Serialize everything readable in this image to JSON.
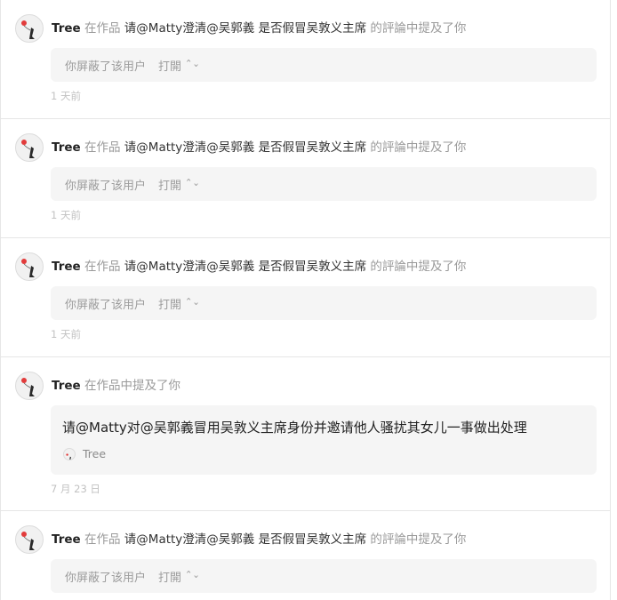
{
  "notifications": [
    {
      "author": "Tree",
      "prefix": "在作品",
      "work_title": "请@Matty澄清@吴郭義 是否假冒吴敦义主席",
      "suffix": "的評論中提及了你",
      "blocked_text": "你屏蔽了该用户",
      "open_label": "打開",
      "time": "1 天前"
    },
    {
      "author": "Tree",
      "prefix": "在作品",
      "work_title": "请@Matty澄清@吴郭義 是否假冒吴敦义主席",
      "suffix": "的評論中提及了你",
      "blocked_text": "你屏蔽了该用户",
      "open_label": "打開",
      "time": "1 天前"
    },
    {
      "author": "Tree",
      "prefix": "在作品",
      "work_title": "请@Matty澄清@吴郭義 是否假冒吴敦义主席",
      "suffix": "的評論中提及了你",
      "blocked_text": "你屏蔽了该用户",
      "open_label": "打開",
      "time": "1 天前"
    },
    {
      "author": "Tree",
      "action": "在作品中提及了你",
      "mention_text": "请@Matty对@吴郭義冒用吴敦义主席身份并邀请他人骚扰其女儿一事做出处理",
      "mention_author": "Tree",
      "time": "7 月 23 日"
    },
    {
      "author": "Tree",
      "prefix": "在作品",
      "work_title": "请@Matty澄清@吴郭義 是否假冒吴敦义主席",
      "suffix": "的評論中提及了你",
      "blocked_text": "你屏蔽了该用户",
      "open_label": "打開"
    }
  ],
  "icons": {
    "avatar": "girl-with-balloon-avatar-icon",
    "open_chevron": "chevron-up-down-icon"
  },
  "colors": {
    "box_bg": "#f5f5f5",
    "muted_text": "#9a9a9a",
    "divider": "#e6e6e6",
    "balloon": "#e23b3b"
  }
}
